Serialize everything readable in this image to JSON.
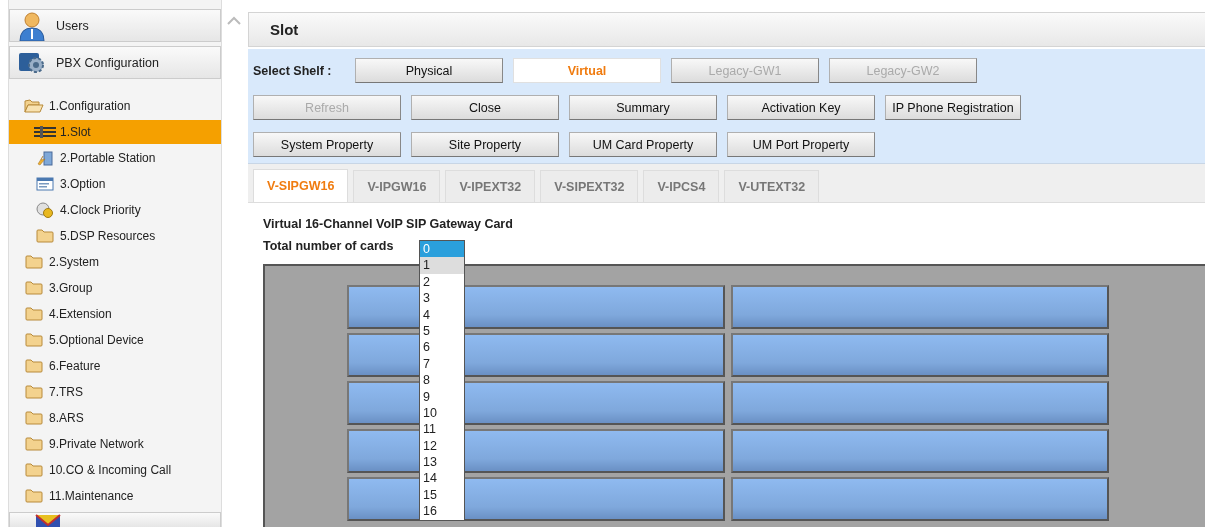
{
  "sidebar": {
    "panels": [
      {
        "kind": "users",
        "label": "Users"
      },
      {
        "kind": "pbx",
        "label": "PBX Configuration"
      }
    ],
    "tree": [
      {
        "kind": "folder",
        "label": "1.Configuration",
        "expanded": true,
        "selected": false,
        "children": [
          {
            "kind": "slot",
            "label": "1.Slot",
            "selected": true
          },
          {
            "kind": "portable",
            "label": "2.Portable Station",
            "selected": false
          },
          {
            "kind": "option",
            "label": "3.Option",
            "selected": false
          },
          {
            "kind": "clock",
            "label": "4.Clock Priority",
            "selected": false
          },
          {
            "kind": "folder",
            "label": "5.DSP Resources",
            "expanded": false,
            "selected": false
          }
        ]
      },
      {
        "kind": "folder",
        "label": "2.System",
        "expanded": false,
        "selected": false
      },
      {
        "kind": "folder",
        "label": "3.Group",
        "expanded": false,
        "selected": false
      },
      {
        "kind": "folder",
        "label": "4.Extension",
        "expanded": false,
        "selected": false
      },
      {
        "kind": "folder",
        "label": "5.Optional Device",
        "expanded": false,
        "selected": false
      },
      {
        "kind": "folder",
        "label": "6.Feature",
        "expanded": false,
        "selected": false
      },
      {
        "kind": "folder",
        "label": "7.TRS",
        "expanded": false,
        "selected": false
      },
      {
        "kind": "folder",
        "label": "8.ARS",
        "expanded": false,
        "selected": false
      },
      {
        "kind": "folder",
        "label": "9.Private Network",
        "expanded": false,
        "selected": false
      },
      {
        "kind": "folder",
        "label": "10.CO & Incoming Call",
        "expanded": false,
        "selected": false
      },
      {
        "kind": "folder",
        "label": "11.Maintenance",
        "expanded": false,
        "selected": false
      }
    ]
  },
  "page": {
    "title": "Slot",
    "shelf": {
      "label": "Select Shelf :",
      "buttons": [
        {
          "label": "Physical",
          "selected": false,
          "disabled": false
        },
        {
          "label": "Virtual",
          "selected": true,
          "disabled": false
        },
        {
          "label": "Legacy-GW1",
          "selected": false,
          "disabled": true
        },
        {
          "label": "Legacy-GW2",
          "selected": false,
          "disabled": true
        }
      ]
    },
    "button_rows": [
      [
        {
          "label": "Refresh",
          "disabled": true
        },
        {
          "label": "Close",
          "disabled": false
        },
        {
          "label": "Summary",
          "disabled": false
        },
        {
          "label": "Activation Key",
          "disabled": false
        },
        {
          "label": "IP Phone Registration",
          "disabled": false
        }
      ],
      [
        {
          "label": "System Property",
          "disabled": false
        },
        {
          "label": "Site Property",
          "disabled": false
        },
        {
          "label": "UM Card Property",
          "disabled": false
        },
        {
          "label": "UM Port Property",
          "disabled": false
        }
      ]
    ],
    "tabs": [
      {
        "label": "V-SIPGW16",
        "selected": true
      },
      {
        "label": "V-IPGW16",
        "selected": false
      },
      {
        "label": "V-IPEXT32",
        "selected": false
      },
      {
        "label": "V-SIPEXT32",
        "selected": false
      },
      {
        "label": "V-IPCS4",
        "selected": false
      },
      {
        "label": "V-UTEXT32",
        "selected": false
      }
    ],
    "card_title": "Virtual 16-Channel VoIP SIP Gateway Card",
    "cards_label": "Total number of cards",
    "cards_options": [
      {
        "label": "0",
        "selected": true,
        "hovered": false
      },
      {
        "label": "1",
        "selected": false,
        "hovered": true
      },
      {
        "label": "2",
        "selected": false,
        "hovered": false
      },
      {
        "label": "3",
        "selected": false,
        "hovered": false
      },
      {
        "label": "4",
        "selected": false,
        "hovered": false
      },
      {
        "label": "5",
        "selected": false,
        "hovered": false
      },
      {
        "label": "6",
        "selected": false,
        "hovered": false
      },
      {
        "label": "7",
        "selected": false,
        "hovered": false
      },
      {
        "label": "8",
        "selected": false,
        "hovered": false
      },
      {
        "label": "9",
        "selected": false,
        "hovered": false
      },
      {
        "label": "10",
        "selected": false,
        "hovered": false
      },
      {
        "label": "11",
        "selected": false,
        "hovered": false
      },
      {
        "label": "12",
        "selected": false,
        "hovered": false
      },
      {
        "label": "13",
        "selected": false,
        "hovered": false
      },
      {
        "label": "14",
        "selected": false,
        "hovered": false
      },
      {
        "label": "15",
        "selected": false,
        "hovered": false
      },
      {
        "label": "16",
        "selected": false,
        "hovered": false
      }
    ]
  }
}
